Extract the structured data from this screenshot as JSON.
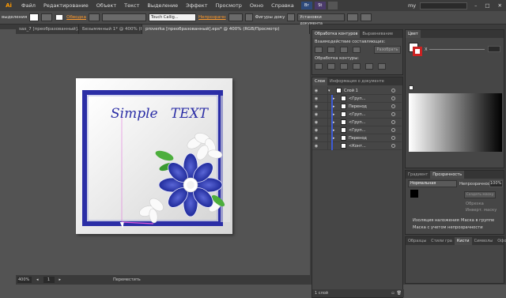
{
  "menu": {
    "items": [
      "Файл",
      "Редактирование",
      "Объект",
      "Текст",
      "Выделение",
      "Эффект",
      "Просмотр",
      "Окно",
      "Справка"
    ],
    "right_label": "my"
  },
  "control_bar": {
    "selection_label": "выделения",
    "stroke_label": "Обводка",
    "brush_label": "Touch Callig...",
    "opacity_label": "Непрозрачн",
    "style_label": "Стиль",
    "gradient_label": "Фигуры доку",
    "settings_button": "Установки документа"
  },
  "doc_tabs": [
    {
      "label": "sax_7 [преобразованный].eps*",
      "active": false
    },
    {
      "label": "Безымянный 1* @ 400% (R...",
      "active": false
    },
    {
      "label": "proverka [преобразованный].eps* @ 400% (RGB/Просмотр)",
      "active": true
    }
  ],
  "artwork": {
    "text": "Simple   TEXT",
    "accent_color": "#2b2ea6"
  },
  "status_bar": {
    "zoom": "400%",
    "page": "1",
    "tool_label": "Переместить"
  },
  "pathfinder": {
    "tabs": [
      "Обработка контуров",
      "Выравнивание"
    ],
    "modes_label": "Взаимодействие составляющих:",
    "expand_button": "Разобрать",
    "pathfinders_label": "Обработка контуры:"
  },
  "layers": {
    "tabs": [
      "Слои",
      "Информация о документе"
    ],
    "rows": [
      {
        "label": "Слой 1",
        "indent": 0
      },
      {
        "label": "<Груп...",
        "indent": 1
      },
      {
        "label": "Перенод",
        "indent": 1
      },
      {
        "label": "<Груп...",
        "indent": 1
      },
      {
        "label": "<Груп...",
        "indent": 1
      },
      {
        "label": "<Груп...",
        "indent": 1
      },
      {
        "label": "Перенод",
        "indent": 1
      },
      {
        "label": "<Конт...",
        "indent": 1
      }
    ],
    "footer": "1 слой"
  },
  "color_panel": {
    "tab": "Цвет",
    "x_label": "X"
  },
  "transparency_panel": {
    "tabs": [
      "Градиент",
      "Прозрачность"
    ],
    "mode": "Нормальная",
    "opacity_label": "Непрозрачность:",
    "opacity_value": "100%",
    "make_mask_button": "Создать маску",
    "clip_label": "Обрезка",
    "invert_label": "Инверт. маску",
    "isolate_label": "Изоляция наложения",
    "knockout_label": "Маска в группе",
    "opacity_mask_label": "Маска с учетом непрозрачности"
  },
  "bottom_tabs": [
    "Образцы",
    "Стили гра",
    "Кисти",
    "Символы",
    "Оформле"
  ]
}
